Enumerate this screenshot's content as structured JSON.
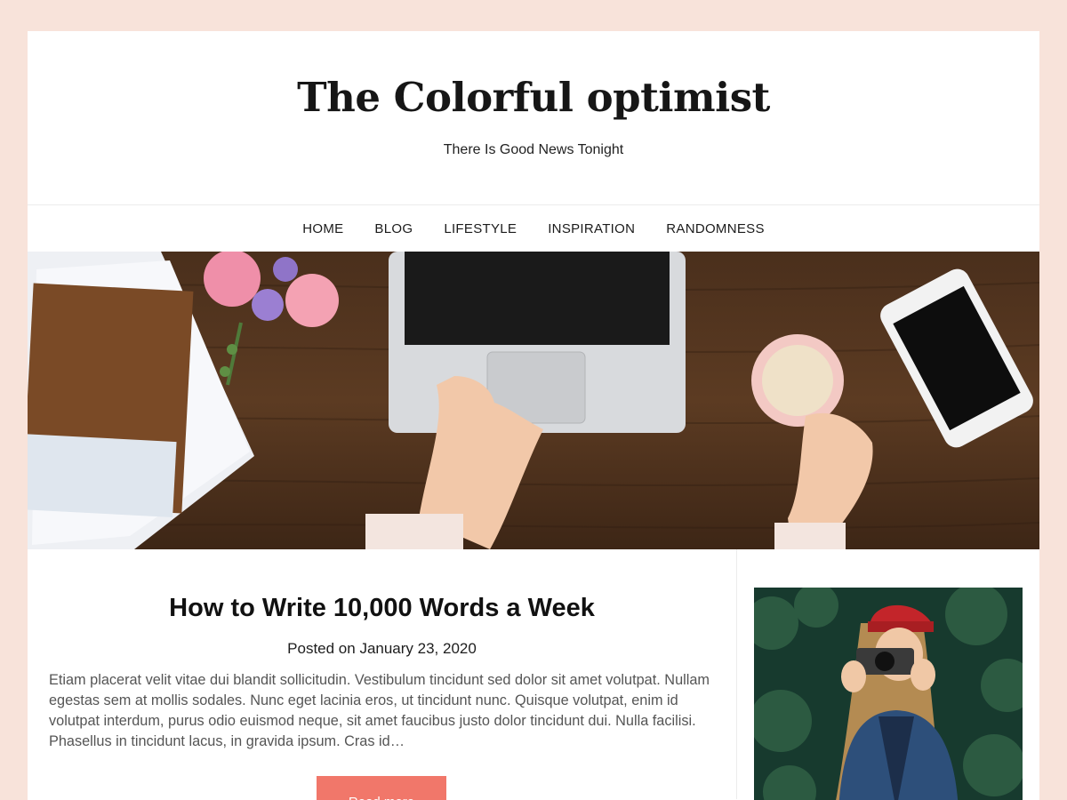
{
  "site": {
    "title": "The Colorful optimist",
    "tagline": "There Is Good News Tonight"
  },
  "nav": {
    "items": [
      "HOME",
      "BLOG",
      "LIFESTYLE",
      "INSPIRATION",
      "RANDOMNESS"
    ]
  },
  "post": {
    "title": "How to Write 10,000 Words a Week",
    "meta": "Posted on January 23, 2020",
    "excerpt": "Etiam placerat velit vitae dui blandit sollicitudin. Vestibulum tincidunt sed dolor sit amet volutpat. Nullam egestas sem at mollis sodales. Nunc eget lacinia eros, ut tincidunt nunc. Quisque volutpat, enim id volutpat interdum, purus odio euismod neque, sit amet faucibus justo dolor tincidunt dui. Nulla facilisi. Phasellus in tincidunt lacus, in gravida ipsum. Cras id…",
    "read_more_label": "Read more"
  },
  "colors": {
    "page_bg": "#f8e3da",
    "accent": "#f1776a",
    "wood": "#5a3a22"
  }
}
